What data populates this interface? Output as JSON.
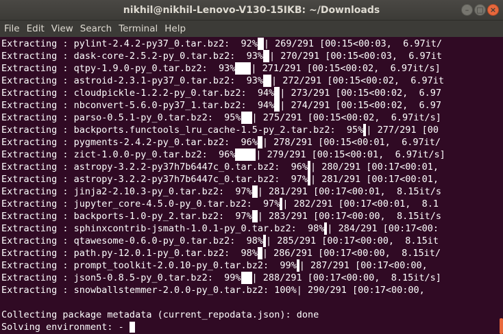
{
  "window": {
    "title": "nikhil@nikhil-Lenovo-V130-15IKB: ~/Downloads",
    "controls": [
      "minimize",
      "maximize",
      "close"
    ]
  },
  "menu": [
    "File",
    "Edit",
    "View",
    "Search",
    "Terminal",
    "Help"
  ],
  "terminal": {
    "lines": [
      {
        "pre": "Extracting : pylint-2.4.2-py37_0.tar.bz2:  92%",
        "block": 9,
        "post": "| 269/291 [00:15<00:03,  6.97it/"
      },
      {
        "pre": "Extracting : dask-core-2.5.2-py_0.tar.bz2:  93%",
        "block": 9,
        "post": "| 270/291 [00:15<00:03,  6.97it"
      },
      {
        "pre": "Extracting : qtpy-1.9.0-py_0.tar.bz2:  93%",
        "block": 23,
        "post": "| 271/291 [00:15<00:02,  6.97it/s]"
      },
      {
        "pre": "Extracting : astroid-2.3.1-py37_0.tar.bz2:  93%",
        "block": 12,
        "post": "| 272/291 [00:15<00:02,  6.97it"
      },
      {
        "pre": "Extracting : cloudpickle-1.2.2-py_0.tar.bz2:  94%",
        "block": 8,
        "post": "| 273/291 [00:15<00:02,  6.97"
      },
      {
        "pre": "Extracting : nbconvert-5.6.0-py37_1.tar.bz2:  94%",
        "block": 8,
        "post": "| 274/291 [00:15<00:02,  6.97"
      },
      {
        "pre": "Extracting : parso-0.5.1-py_0.tar.bz2:  95%",
        "block": 16,
        "post": "| 275/291 [00:15<00:02,  6.97it/s]"
      },
      {
        "pre": "Extracting : backports.functools_lru_cache-1.5-py_2.tar.bz2:  95%",
        "block": 4,
        "post": "| 277/291 [00"
      },
      {
        "pre": "Extracting : pygments-2.4.2-py_0.tar.bz2:  96%",
        "block": 7,
        "post": "| 278/291 [00:15<00:01,  6.97it/"
      },
      {
        "pre": "Extracting : zict-1.0.0-py_0.tar.bz2:  96%",
        "block": 30,
        "post": "| 279/291 [00:15<00:01,  6.97it/s]"
      },
      {
        "pre": "Extracting : astropy-3.2.2-py37h7b6447c_0.tar.bz2:  96%",
        "block": 4,
        "post": "| 280/291 [00:17<00:01,"
      },
      {
        "pre": "Extracting : astropy-3.2.2-py37h7b6447c_0.tar.bz2:  97%",
        "block": 4,
        "post": "| 281/291 [00:17<00:01,"
      },
      {
        "pre": "Extracting : jinja2-2.10.3-py_0.tar.bz2:  97%",
        "block": 8,
        "post": "| 281/291 [00:17<00:01,  8.15it/s"
      },
      {
        "pre": "Extracting : jupyter_core-4.5.0-py_0.tar.bz2:  97%",
        "block": 4,
        "post": "| 282/291 [00:17<00:01,  8.1"
      },
      {
        "pre": "Extracting : backports-1.0-py_2.tar.bz2:  97%",
        "block": 8,
        "post": "| 283/291 [00:17<00:00,  8.15it/s"
      },
      {
        "pre": "Extracting : sphinxcontrib-jsmath-1.0.1-py_0.tar.bz2:  98%",
        "block": 4,
        "post": "| 284/291 [00:17<00:"
      },
      {
        "pre": "Extracting : qtawesome-0.6.0-py_0.tar.bz2:  98%",
        "block": 4,
        "post": "| 285/291 [00:17<00:00,  8.15it"
      },
      {
        "pre": "Extracting : path.py-12.0.1-py_0.tar.bz2:  98%",
        "block": 7,
        "post": "| 286/291 [00:17<00:00,  8.15it/"
      },
      {
        "pre": "Extracting : prompt_toolkit-2.0.10-py_0.tar.bz2:  99%",
        "block": 4,
        "post": "| 287/291 [00:17<00:00,"
      },
      {
        "pre": "Extracting : json5-0.8.5-py_0.tar.bz2:  99%",
        "block": 16,
        "post": "| 288/291 [00:17<00:00,  8.15it/s]"
      },
      {
        "pre": "Extracting : snowballstemmer-2.0.0-py_0.tar.bz2: 100%",
        "block": 0,
        "post": "| 290/291 [00:17<00:00,"
      },
      {
        "pre": "",
        "block": 0,
        "post": ""
      },
      {
        "pre": "Collecting package metadata (current_repodata.json): done",
        "block": 0,
        "post": ""
      },
      {
        "pre": "Solving environment: - ",
        "block": 0,
        "post": "",
        "cursor": true
      }
    ]
  },
  "colors": {
    "background": "#300a24",
    "foreground": "#ffffff",
    "titlebar": "#3c3b37",
    "close_button": "#e8683c"
  }
}
